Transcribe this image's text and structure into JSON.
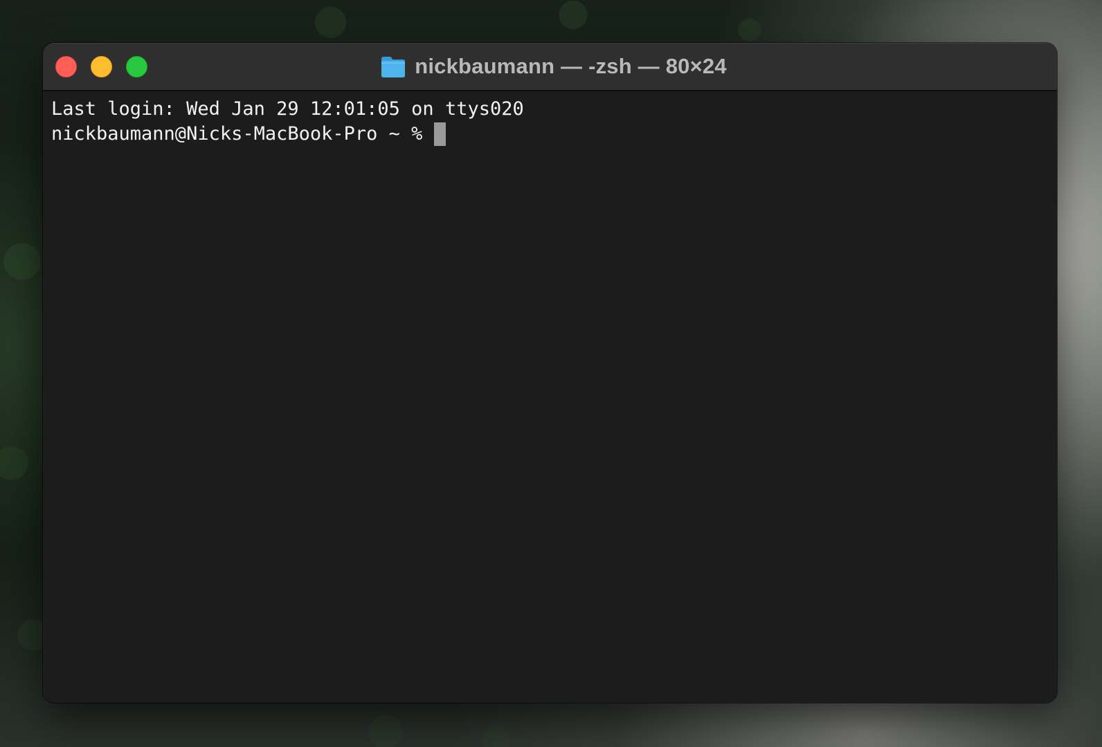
{
  "window": {
    "title": "nickbaumann — -zsh — 80×24",
    "folder_icon": "folder-icon"
  },
  "traffic_lights": {
    "close_color": "#ff5f57",
    "minimize_color": "#febc2e",
    "zoom_color": "#28c840"
  },
  "terminal": {
    "last_login": "Last login: Wed Jan 29 12:01:05 on ttys020",
    "prompt": "nickbaumann@Nicks-MacBook-Pro ~ % "
  },
  "colors": {
    "background": "#1c1c1c",
    "text": "#f2f2f2",
    "cursor": "#9a9a9a",
    "folder": "#4fb4ec"
  }
}
